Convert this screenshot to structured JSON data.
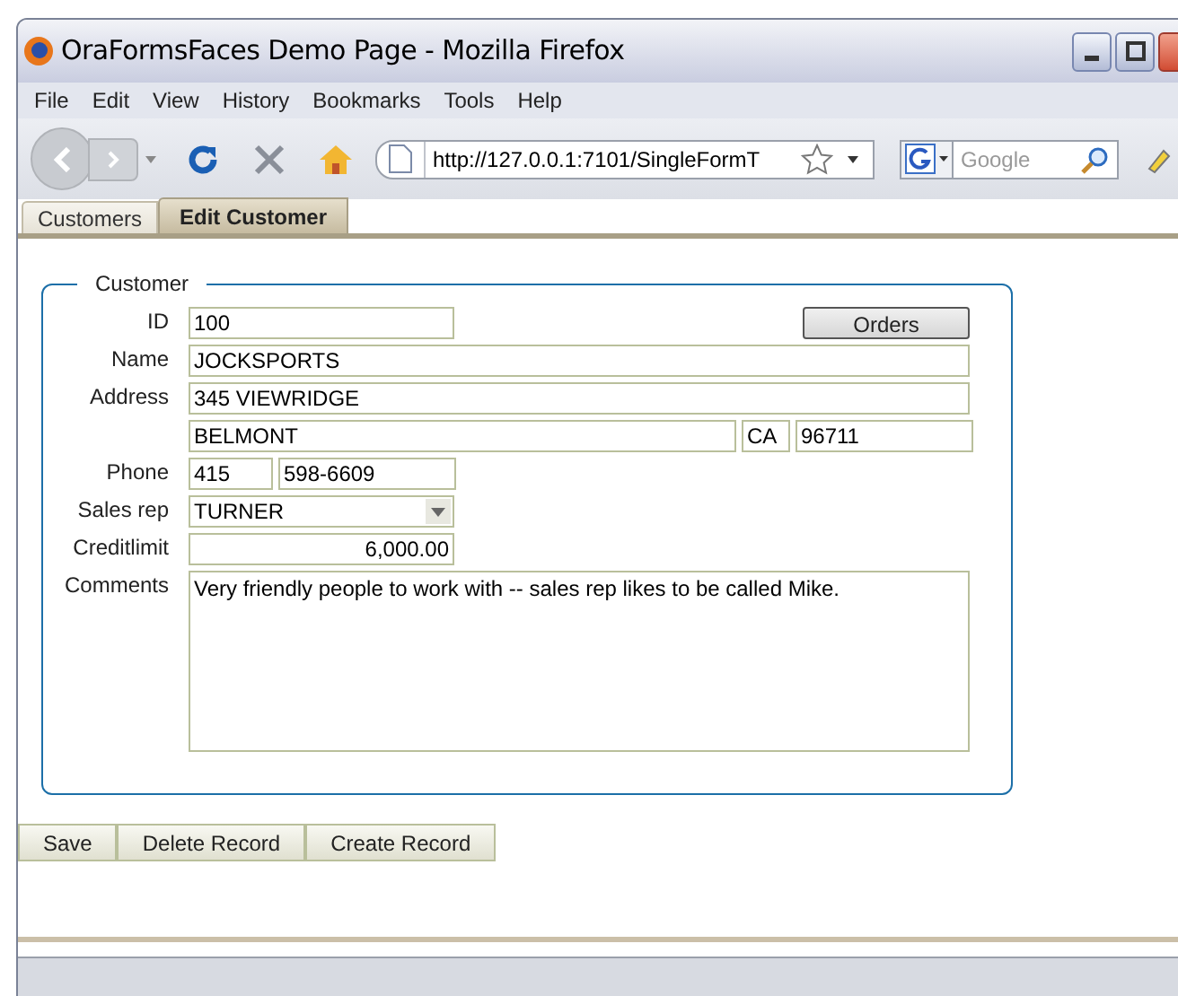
{
  "window": {
    "title": "OraFormsFaces Demo Page - Mozilla Firefox"
  },
  "menu": [
    "File",
    "Edit",
    "View",
    "History",
    "Bookmarks",
    "Tools",
    "Help"
  ],
  "address_bar": {
    "value": "http://127.0.0.1:7101/SingleFormT"
  },
  "search": {
    "placeholder": "Google"
  },
  "tabs": [
    {
      "label": "Customers",
      "selected": false
    },
    {
      "label": "Edit Customer",
      "selected": true
    }
  ],
  "form": {
    "legend": "Customer",
    "action_button": "Orders",
    "rows": [
      {
        "label": "ID",
        "fields": [
          {
            "kind": "text",
            "value": "100"
          }
        ]
      },
      {
        "label": "Name",
        "fields": [
          {
            "kind": "text",
            "value": "JOCKSPORTS"
          }
        ]
      },
      {
        "label": "Address",
        "fields": [
          {
            "kind": "text",
            "value": "345 VIEWRIDGE"
          }
        ]
      },
      {
        "fields": [
          {
            "kind": "text",
            "value": "BELMONT"
          },
          {
            "kind": "text",
            "value": "CA"
          },
          {
            "kind": "text",
            "value": "96711"
          }
        ]
      },
      {
        "label": "Phone",
        "fields": [
          {
            "kind": "text",
            "value": "415"
          },
          {
            "kind": "text",
            "value": "598-6609"
          }
        ]
      },
      {
        "label": "Sales rep",
        "fields": [
          {
            "kind": "select",
            "value": "TURNER"
          }
        ]
      },
      {
        "label": "Creditlimit",
        "fields": [
          {
            "kind": "number",
            "value": "6,000.00"
          }
        ]
      },
      {
        "label": "Comments",
        "fields": [
          {
            "kind": "textarea",
            "value": "Very friendly people to work with -- sales rep likes to be called Mike."
          }
        ]
      }
    ]
  },
  "buttons": [
    "Save",
    "Delete Record",
    "Create Record"
  ]
}
